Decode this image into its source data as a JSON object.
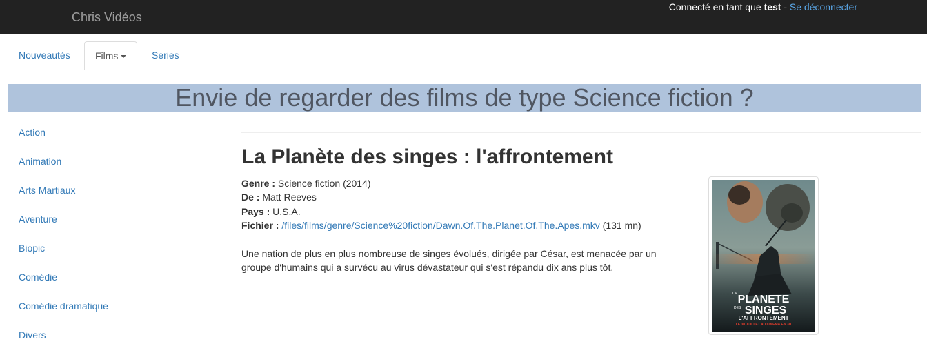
{
  "navbar": {
    "brand": "Chris Vidéos",
    "login_prefix": "Connecté en tant que ",
    "username": "test",
    "separator": " - ",
    "logout_label": "Se déconnecter"
  },
  "tabs": [
    {
      "label": "Nouveautés"
    },
    {
      "label": "Films"
    },
    {
      "label": "Series"
    }
  ],
  "banner": {
    "text": "Envie de regarder des films de type Science fiction ?"
  },
  "sidebar": {
    "items": [
      {
        "label": "Action"
      },
      {
        "label": "Animation"
      },
      {
        "label": "Arts Martiaux"
      },
      {
        "label": "Aventure"
      },
      {
        "label": "Biopic"
      },
      {
        "label": "Comédie"
      },
      {
        "label": "Comédie dramatique"
      },
      {
        "label": "Divers"
      }
    ]
  },
  "movie": {
    "title": "La Planète des singes : l'affrontement",
    "genre_label": "Genre :",
    "genre_value": "Science fiction (2014)",
    "director_label": "De :",
    "director_value": "Matt Reeves",
    "country_label": "Pays :",
    "country_value": "U.S.A.",
    "file_label": "Fichier :",
    "file_path": "/files/films/genre/Science%20fiction/Dawn.Of.The.Planet.Of.The.Apes.mkv",
    "duration": "(131 mn)",
    "synopsis": "Une nation de plus en plus nombreuse de singes évolués, dirigée par César, est menacée par un groupe d'humains qui a survécu au virus dévastateur qui s'est répandu dix ans plus tôt.",
    "poster": {
      "line1": "LA",
      "line2": "PLANETE",
      "line3": "DES",
      "line4": "SINGES",
      "line5": "L'AFFRONTEMENT",
      "line6": "LE 30 JUILLET AU CINEMA EN 3D"
    }
  },
  "colors": {
    "navbar_bg": "#222222",
    "link": "#337ab7",
    "banner_bg": "#afc3dc",
    "logout_link": "#5aa7e8"
  }
}
